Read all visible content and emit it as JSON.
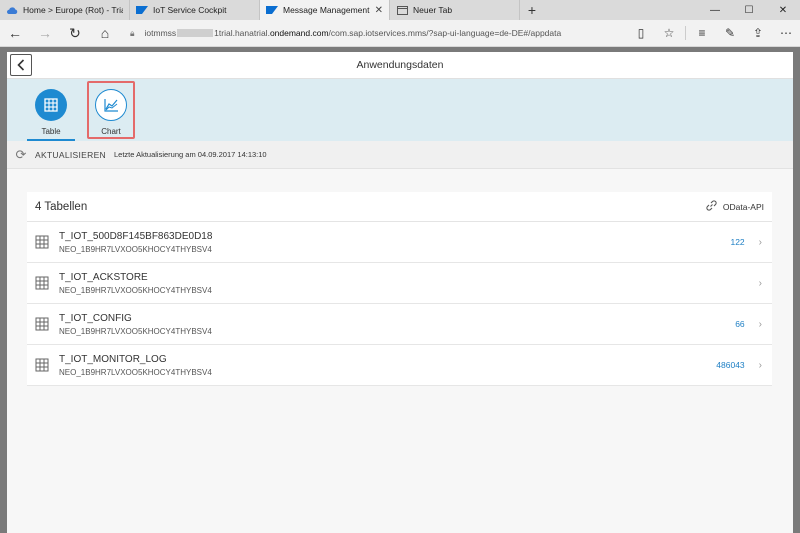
{
  "browser": {
    "tabs": [
      {
        "label": "Home > Europe (Rot) - Trial",
        "icon": "cloud-icon",
        "active": false
      },
      {
        "label": "IoT Service Cockpit",
        "icon": "sap-logo-icon",
        "active": false
      },
      {
        "label": "Message Management",
        "icon": "sap-logo-icon",
        "active": true
      },
      {
        "label": "Neuer Tab",
        "icon": "tab-page-icon",
        "active": false
      }
    ],
    "address": {
      "prefix": "iotmmss",
      "host_suffix": "1trial.hanatrial.",
      "host": "ondemand.com",
      "path": "/com.sap.iotservices.mms/?sap-ui-language=de-DE#/appdata"
    }
  },
  "app": {
    "title": "Anwendungsdaten",
    "views": [
      {
        "label": "Table",
        "icon": "table-icon",
        "selected": true
      },
      {
        "label": "Chart",
        "icon": "chart-icon",
        "selected": false
      }
    ],
    "refresh": {
      "button_label": "AKTUALISIEREN",
      "last_update": "Letzte Aktualisierung am 04.09.2017 14:13:10"
    },
    "panel": {
      "title": "4 Tabellen",
      "odata_label": "OData-API"
    },
    "tables": [
      {
        "name": "T_IOT_500D8F145BF863DE0D18",
        "schema": "NEO_1B9HR7LVXOO5KHOCY4THYBSV4",
        "count": "122"
      },
      {
        "name": "T_IOT_ACKSTORE",
        "schema": "NEO_1B9HR7LVXOO5KHOCY4THYBSV4",
        "count": ""
      },
      {
        "name": "T_IOT_CONFIG",
        "schema": "NEO_1B9HR7LVXOO5KHOCY4THYBSV4",
        "count": "66"
      },
      {
        "name": "T_IOT_MONITOR_LOG",
        "schema": "NEO_1B9HR7LVXOO5KHOCY4THYBSV4",
        "count": "486043"
      }
    ]
  },
  "colors": {
    "accent": "#1e8ad1",
    "highlight": "#e46a6a",
    "count_link": "#1e7fc4",
    "iconbar_bg": "#dcecf2"
  }
}
